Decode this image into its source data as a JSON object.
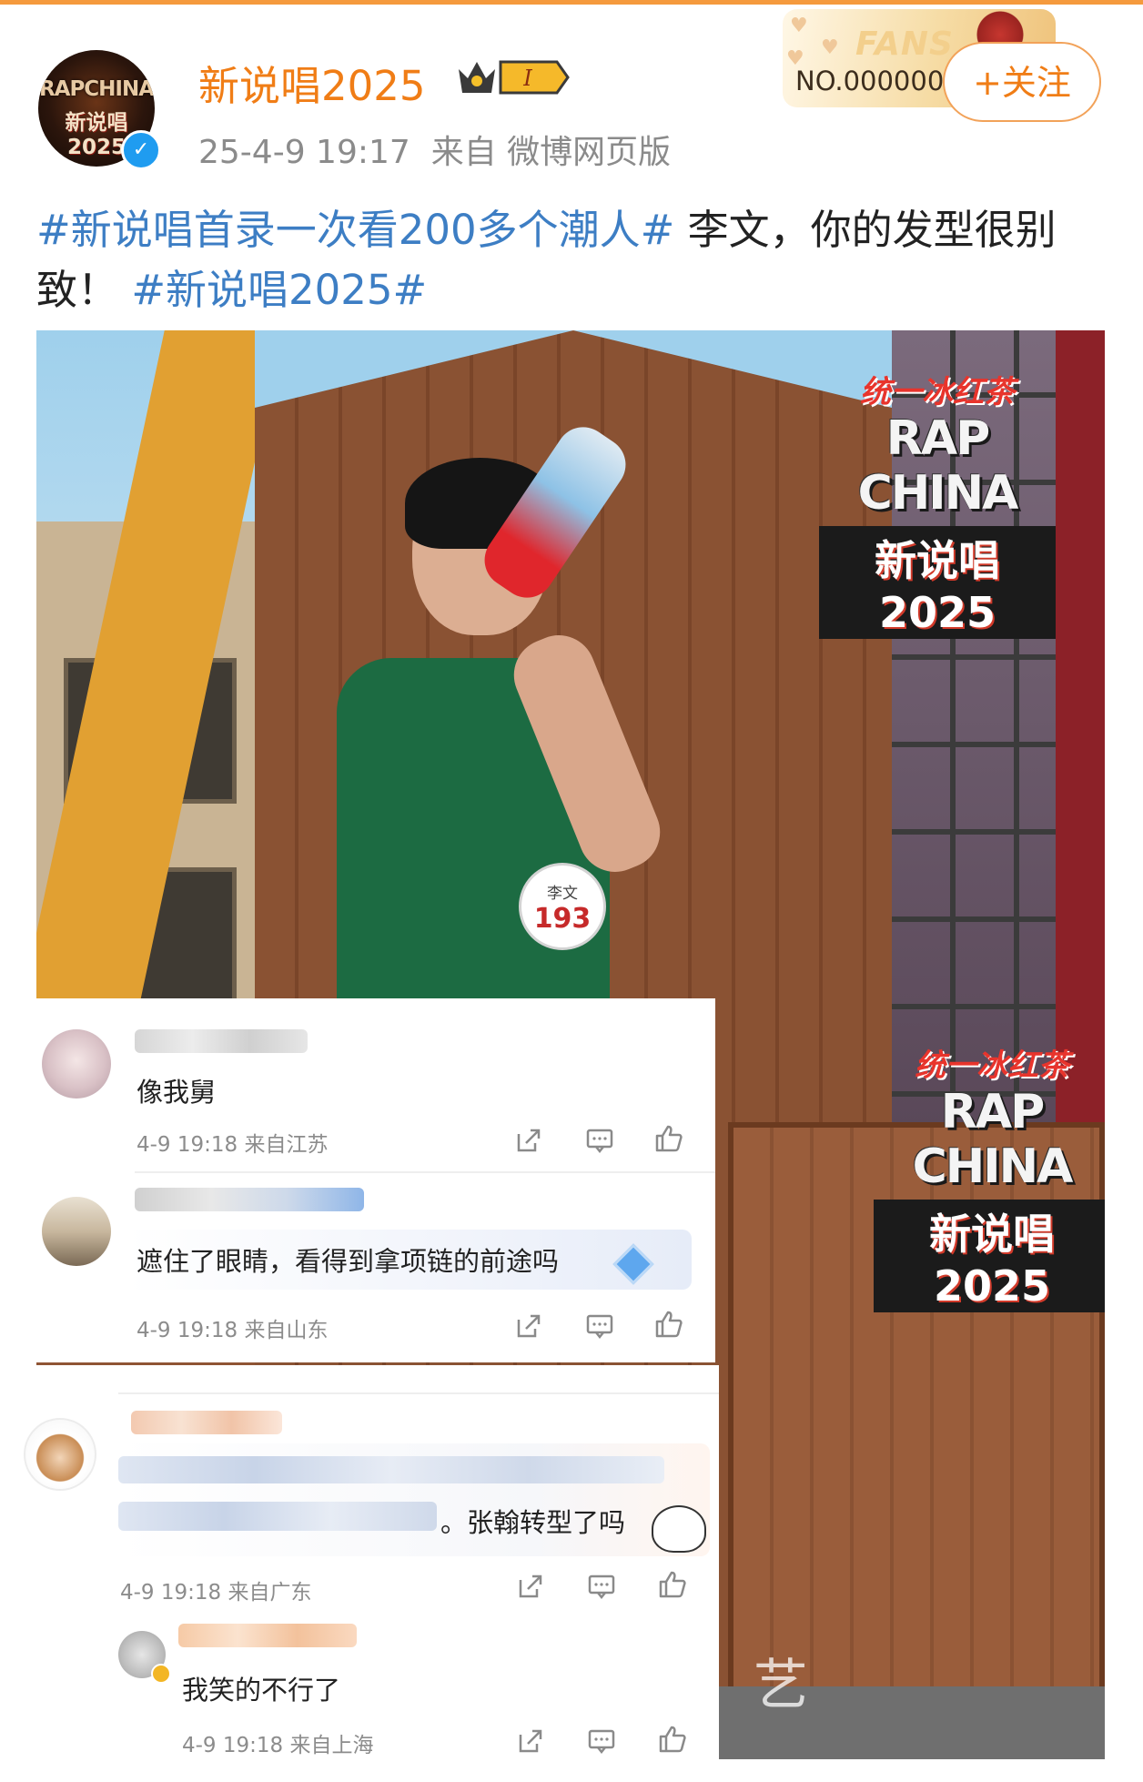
{
  "post": {
    "username": "新说唱2025",
    "timestamp": "25-4-9 19:17",
    "source": "来自 微博网页版",
    "follow_label": "+关注",
    "fans_card": {
      "label": "FANS",
      "number": "NO.000000"
    },
    "avatar_logo_top": "RAPCHINA",
    "avatar_logo_bottom": "新说唱2025",
    "verified_icon": "verified-check-icon",
    "crown_badge_level": "I",
    "text": {
      "hashtag1": "#新说唱首录一次看200多个潮人#",
      "body": " 李文，你的发型很别致！",
      "hashtag2": "#新说唱2025#"
    }
  },
  "photo": {
    "logo_sponsor": "统一冰红茶",
    "logo_rap": "RAP CHINA",
    "logo_cn": "新说唱2025",
    "tag_name": "李文",
    "tag_number": "193",
    "watermark": "艺"
  },
  "comments": [
    {
      "text": "像我舅",
      "time": "4-9 19:18",
      "location": "来自江苏"
    },
    {
      "text": "遮住了眼睛，看得到拿项链的前途吗",
      "time": "4-9 19:18",
      "location": "来自山东"
    },
    {
      "text": "。张翰转型了吗",
      "time": "4-9 19:18",
      "location": "来自广东"
    },
    {
      "text": "我笑的不行了",
      "time": "4-9 19:18",
      "location": "来自上海"
    }
  ],
  "icons": {
    "share": "share-icon",
    "comment": "comment-icon",
    "like": "like-icon"
  },
  "colors": {
    "accent": "#f07d16",
    "hashtag": "#3d7ec4",
    "verify": "#1f9cf0"
  }
}
